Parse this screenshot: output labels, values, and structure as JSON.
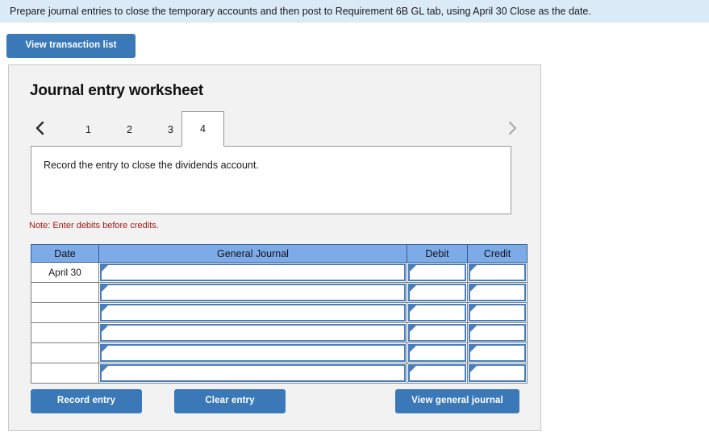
{
  "banner": {
    "text": "Prepare journal entries to close the temporary accounts and then post to Requirement 6B GL tab, using April 30 Close as the date."
  },
  "toolbar": {
    "view_transaction_list_label": "View transaction list"
  },
  "panel": {
    "title": "Journal entry worksheet",
    "tabs": [
      {
        "label": "1",
        "active": false
      },
      {
        "label": "2",
        "active": false
      },
      {
        "label": "3",
        "active": false
      },
      {
        "label": "4",
        "active": true
      }
    ],
    "nav": {
      "prev_icon": "chevron-left-icon",
      "next_icon": "chevron-right-icon"
    },
    "instruction": "Record the entry to close the dividends account.",
    "note": "Note: Enter debits before credits."
  },
  "table": {
    "headers": [
      "Date",
      "General Journal",
      "Debit",
      "Credit"
    ],
    "rows": [
      {
        "date": "April 30",
        "general_journal": "",
        "debit": "",
        "credit": ""
      },
      {
        "date": "",
        "general_journal": "",
        "debit": "",
        "credit": ""
      },
      {
        "date": "",
        "general_journal": "",
        "debit": "",
        "credit": ""
      },
      {
        "date": "",
        "general_journal": "",
        "debit": "",
        "credit": ""
      },
      {
        "date": "",
        "general_journal": "",
        "debit": "",
        "credit": ""
      },
      {
        "date": "",
        "general_journal": "",
        "debit": "",
        "credit": ""
      }
    ]
  },
  "actions": {
    "record_entry_label": "Record entry",
    "clear_entry_label": "Clear entry",
    "view_general_journal_label": "View general journal"
  },
  "colors": {
    "banner_bg": "#dbeaf7",
    "button_blue": "#3b78b8",
    "header_blue": "#7cabe7",
    "cell_border_blue": "#4a7ebb",
    "note_red": "#a01818",
    "panel_bg": "#f2f2f2"
  }
}
